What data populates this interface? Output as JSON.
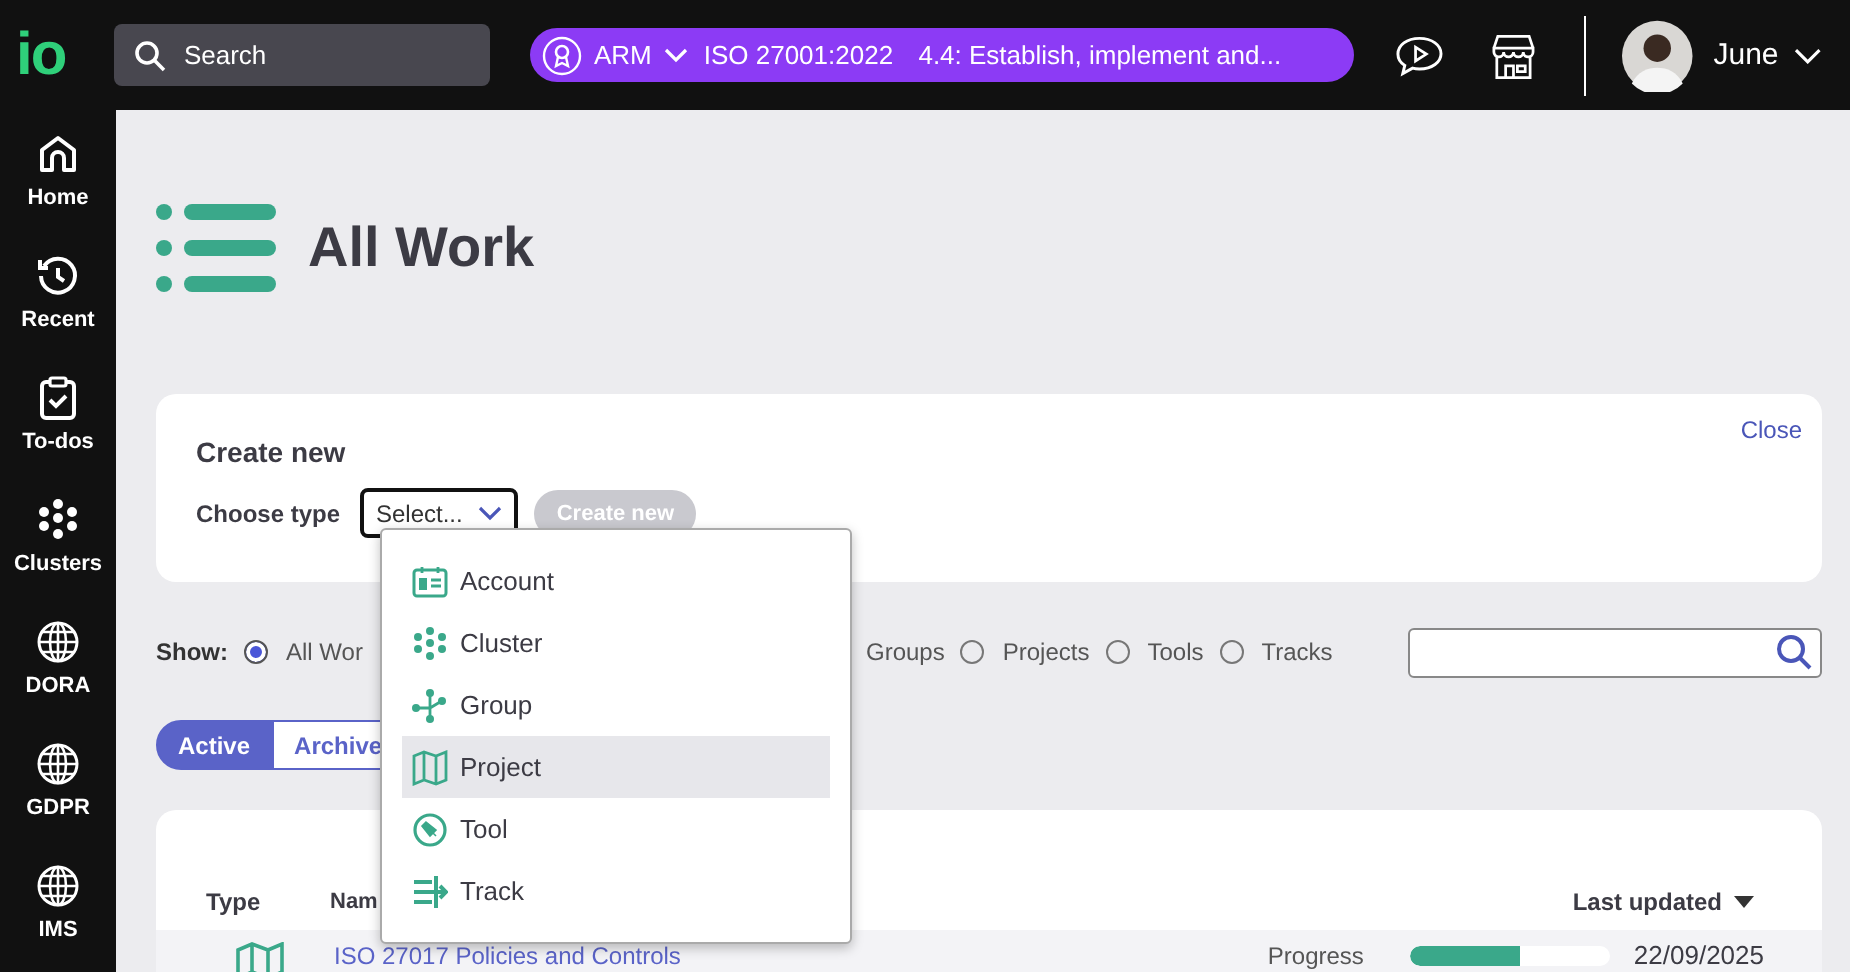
{
  "header": {
    "logo": "io",
    "search": {
      "placeholder": "Search"
    },
    "context": {
      "org": "ARM",
      "standard": "ISO 27001:2022",
      "clause": "4.4: Establish, implement and..."
    },
    "user": {
      "name": "June"
    }
  },
  "sidebar": {
    "items": [
      {
        "label": "Home"
      },
      {
        "label": "Recent"
      },
      {
        "label": "To-dos"
      },
      {
        "label": "Clusters"
      },
      {
        "label": "DORA"
      },
      {
        "label": "GDPR"
      },
      {
        "label": "IMS"
      }
    ]
  },
  "page": {
    "title": "All Work"
  },
  "create_panel": {
    "title": "Create new",
    "close": "Close",
    "type_label": "Choose type",
    "select": {
      "value": "Select..."
    },
    "button": {
      "label": "Create new",
      "disabled": true
    }
  },
  "dropdown": {
    "options": [
      {
        "label": "Account",
        "highlighted": false
      },
      {
        "label": "Cluster",
        "highlighted": false
      },
      {
        "label": "Group",
        "highlighted": false
      },
      {
        "label": "Project",
        "highlighted": true
      },
      {
        "label": "Tool",
        "highlighted": false
      },
      {
        "label": "Track",
        "highlighted": false
      }
    ]
  },
  "filter": {
    "label": "Show:",
    "options": [
      {
        "label": "All Wor",
        "kind": "radio",
        "selected": true
      },
      {
        "label": "Groups",
        "kind": "label"
      },
      {
        "label": "Projects",
        "kind": "radio",
        "selected": false
      },
      {
        "label": "Tools",
        "kind": "radio",
        "selected": false
      },
      {
        "label": "Tracks",
        "kind": "radio",
        "selected": false
      }
    ]
  },
  "tabs": [
    {
      "label": "Active",
      "selected": true
    },
    {
      "label": "Archive",
      "selected": false
    }
  ],
  "table": {
    "columns": [
      "Type",
      "Nam",
      "Last updated"
    ],
    "rows": [
      {
        "name": "ISO 27017 Policies and Controls",
        "progress_label": "Progress",
        "level": 0.55,
        "updated": "22/09/2025"
      }
    ]
  }
}
